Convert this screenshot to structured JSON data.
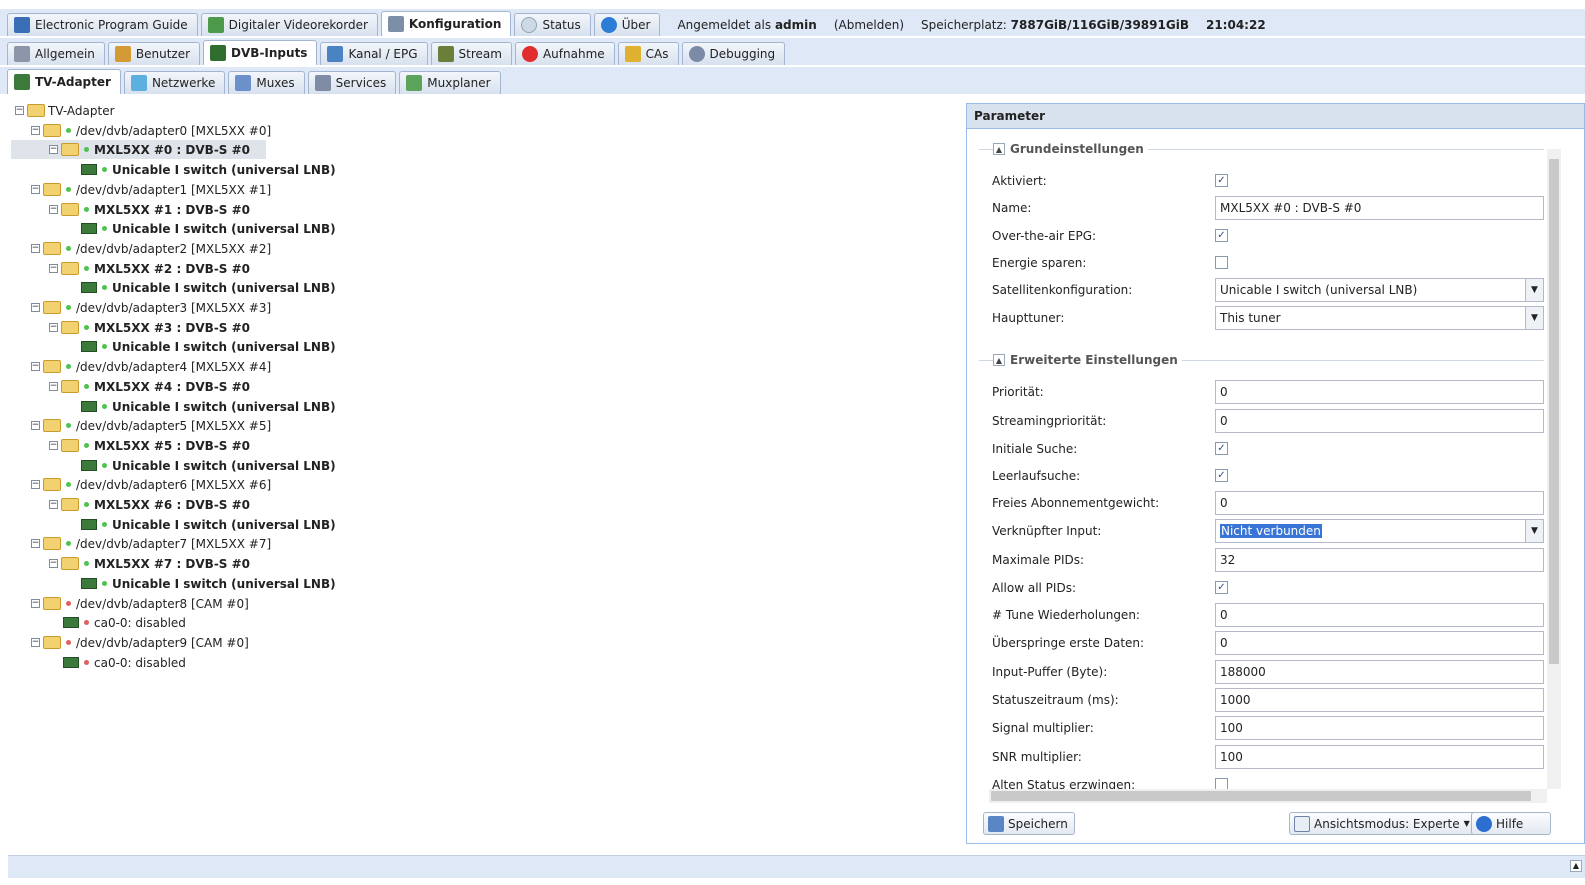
{
  "main_tabs": [
    {
      "label": "Electronic Program Guide",
      "icon": "epg-icon"
    },
    {
      "label": "Digitaler Videorekorder",
      "icon": "dvr-icon"
    },
    {
      "label": "Konfiguration",
      "icon": "wrench-icon",
      "active": true
    },
    {
      "label": "Status",
      "icon": "eye-icon"
    },
    {
      "label": "Über",
      "icon": "info-icon"
    }
  ],
  "session": {
    "logged_in_prefix": "Angemeldet als",
    "user": "admin",
    "logout": "(Abmelden)",
    "storage_label": "Speicherplatz:",
    "storage_value": "7887GiB/116GiB/39891GiB",
    "time": "21:04:22"
  },
  "config_tabs": [
    {
      "label": "Allgemein"
    },
    {
      "label": "Benutzer"
    },
    {
      "label": "DVB-Inputs"
    },
    {
      "label": "Kanal / EPG"
    },
    {
      "label": "Stream"
    },
    {
      "label": "Aufnahme"
    },
    {
      "label": "CAs"
    },
    {
      "label": "Debugging"
    }
  ],
  "dvb_tabs": [
    {
      "label": "TV-Adapter"
    },
    {
      "label": "Netzwerke"
    },
    {
      "label": "Muxes"
    },
    {
      "label": "Services"
    },
    {
      "label": "Muxplaner"
    }
  ],
  "tree": {
    "root": "TV-Adapter",
    "adapters": [
      {
        "path": "/dev/dvb/adapter0 [MXL5XX #0]",
        "frontend": "MXL5XX #0 : DVB-S #0",
        "leaf": "Unicable I switch (universal LNB)"
      },
      {
        "path": "/dev/dvb/adapter1 [MXL5XX #1]",
        "frontend": "MXL5XX #1 : DVB-S #0",
        "leaf": "Unicable I switch (universal LNB)"
      },
      {
        "path": "/dev/dvb/adapter2 [MXL5XX #2]",
        "frontend": "MXL5XX #2 : DVB-S #0",
        "leaf": "Unicable I switch (universal LNB)"
      },
      {
        "path": "/dev/dvb/adapter3 [MXL5XX #3]",
        "frontend": "MXL5XX #3 : DVB-S #0",
        "leaf": "Unicable I switch (universal LNB)"
      },
      {
        "path": "/dev/dvb/adapter4 [MXL5XX #4]",
        "frontend": "MXL5XX #4 : DVB-S #0",
        "leaf": "Unicable I switch (universal LNB)"
      },
      {
        "path": "/dev/dvb/adapter5 [MXL5XX #5]",
        "frontend": "MXL5XX #5 : DVB-S #0",
        "leaf": "Unicable I switch (universal LNB)"
      },
      {
        "path": "/dev/dvb/adapter6 [MXL5XX #6]",
        "frontend": "MXL5XX #6 : DVB-S #0",
        "leaf": "Unicable I switch (universal LNB)"
      },
      {
        "path": "/dev/dvb/adapter7 [MXL5XX #7]",
        "frontend": "MXL5XX #7 : DVB-S #0",
        "leaf": "Unicable I switch (universal LNB)"
      }
    ],
    "cam_adapters": [
      {
        "path": "/dev/dvb/adapter8 [CAM #0]",
        "leaf": "ca0-0: disabled"
      },
      {
        "path": "/dev/dvb/adapter9 [CAM #0]",
        "leaf": "ca0-0: disabled"
      }
    ]
  },
  "panel": {
    "title": "Parameter",
    "basic_title": "Grundeinstellungen",
    "advanced_title": "Erweiterte Einstellungen",
    "basic": [
      {
        "label": "Aktiviert:",
        "type": "checkbox",
        "checked": true
      },
      {
        "label": "Name:",
        "type": "text",
        "value": "MXL5XX #0 : DVB-S #0"
      },
      {
        "label": "Over-the-air EPG:",
        "type": "checkbox",
        "checked": true
      },
      {
        "label": "Energie sparen:",
        "type": "checkbox",
        "checked": false
      },
      {
        "label": "Satellitenkonfiguration:",
        "type": "select",
        "value": "Unicable I switch (universal LNB)"
      },
      {
        "label": "Haupttuner:",
        "type": "select",
        "value": "This tuner"
      }
    ],
    "advanced": [
      {
        "label": "Priorität:",
        "type": "text",
        "value": "0"
      },
      {
        "label": "Streamingpriorität:",
        "type": "text",
        "value": "0"
      },
      {
        "label": "Initiale Suche:",
        "type": "checkbox",
        "checked": true
      },
      {
        "label": "Leerlaufsuche:",
        "type": "checkbox",
        "checked": true
      },
      {
        "label": "Freies Abonnementgewicht:",
        "type": "text",
        "value": "0"
      },
      {
        "label": "Verknüpfter Input:",
        "type": "select",
        "value": "Nicht verbunden",
        "highlight": true
      },
      {
        "label": "Maximale PIDs:",
        "type": "text",
        "value": "32"
      },
      {
        "label": "Allow all PIDs:",
        "type": "checkbox",
        "checked": true
      },
      {
        "label": "# Tune Wiederholungen:",
        "type": "text",
        "value": "0"
      },
      {
        "label": "Überspringe erste Daten:",
        "type": "text",
        "value": "0"
      },
      {
        "label": "Input-Puffer (Byte):",
        "type": "text",
        "value": "188000"
      },
      {
        "label": "Statuszeitraum (ms):",
        "type": "text",
        "value": "1000"
      },
      {
        "label": "Signal multiplier:",
        "type": "text",
        "value": "100"
      },
      {
        "label": "SNR multiplier:",
        "type": "text",
        "value": "100"
      },
      {
        "label": "Alten Status erzwingen:",
        "type": "checkbox",
        "checked": false
      }
    ],
    "save_label": "Speichern",
    "view_mode_label": "Ansichtsmodus: Experte",
    "help_label": "Hilfe"
  }
}
